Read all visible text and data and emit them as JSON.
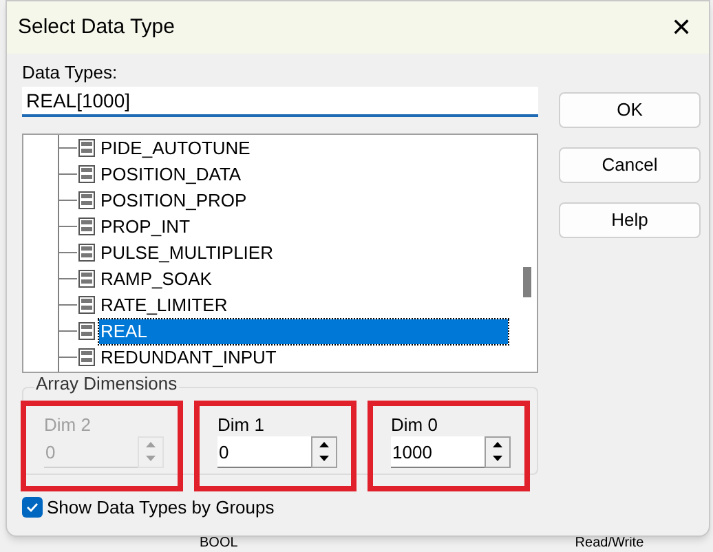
{
  "window": {
    "title": "Select Data Type",
    "close": "✕"
  },
  "data_types": {
    "label": "Data Types:",
    "value": "REAL[1000]"
  },
  "buttons": [
    "OK",
    "Cancel",
    "Help"
  ],
  "tree_items": [
    {
      "label": "PIDE_AUTOTUNE",
      "selected": false
    },
    {
      "label": "POSITION_DATA",
      "selected": false
    },
    {
      "label": "POSITION_PROP",
      "selected": false
    },
    {
      "label": "PROP_INT",
      "selected": false
    },
    {
      "label": "PULSE_MULTIPLIER",
      "selected": false
    },
    {
      "label": "RAMP_SOAK",
      "selected": false
    },
    {
      "label": "RATE_LIMITER",
      "selected": false
    },
    {
      "label": "REAL",
      "selected": true
    },
    {
      "label": "REDUNDANT_INPUT",
      "selected": false
    }
  ],
  "array_dimensions": {
    "title": "Array Dimensions",
    "dims": [
      {
        "label": "Dim 2",
        "value": "0",
        "disabled": true,
        "highlighted": true
      },
      {
        "label": "Dim 1",
        "value": "0",
        "disabled": false,
        "highlighted": true
      },
      {
        "label": "Dim 0",
        "value": "1000",
        "disabled": false,
        "highlighted": true
      }
    ]
  },
  "show_by_groups": {
    "label": "Show Data Types by Groups",
    "checked": true
  },
  "background": [
    "BOOL",
    "Read/Write"
  ]
}
